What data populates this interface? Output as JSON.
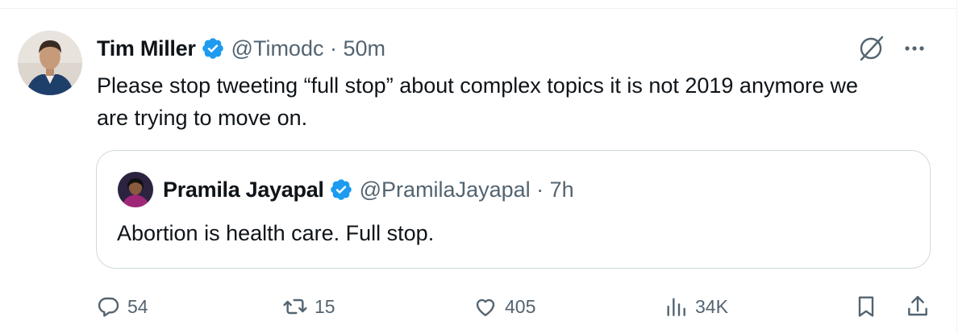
{
  "tweet": {
    "name": "Tim Miller",
    "handle_time": "@Timodc · 50m",
    "text": "Please stop tweeting “full stop” about complex topics it is not 2019 anymore we are trying to move on.",
    "avatar_icon": "avatar-photo-icon"
  },
  "quote": {
    "name": "Pramila Jayapal",
    "handle_time": "@PramilaJayapal · 7h",
    "text": "Abortion is health care. Full stop.",
    "avatar_icon": "avatar-photo-icon"
  },
  "actions": {
    "replies": "54",
    "reposts": "15",
    "likes": "405",
    "views": "34K"
  },
  "colors": {
    "verified": "#1d9bf0",
    "muted": "#536471",
    "text": "#0f1419",
    "border": "#cfd9de"
  },
  "icons": [
    "verified-badge-icon",
    "grok-icon",
    "more-icon",
    "reply-icon",
    "repost-icon",
    "like-icon",
    "views-icon",
    "bookmark-icon",
    "share-icon"
  ]
}
